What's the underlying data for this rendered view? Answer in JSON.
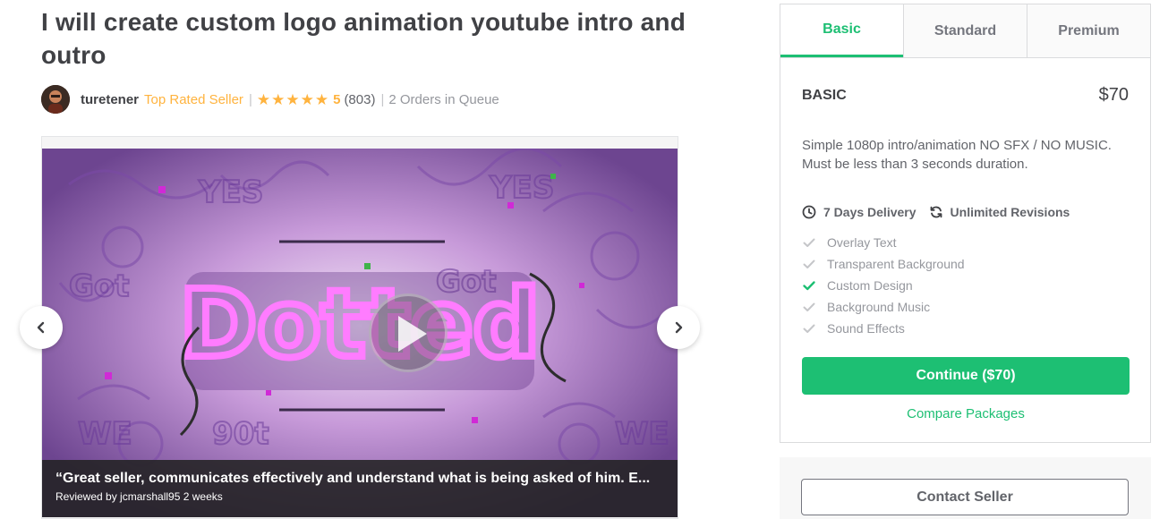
{
  "gig": {
    "title": "I will create custom logo animation youtube intro and outro"
  },
  "seller": {
    "username": "turetener",
    "level": "Top Rated Seller",
    "rating": "5",
    "rating_count": "(803)",
    "queue": "2 Orders in Queue",
    "stars": 5
  },
  "media": {
    "review_text": "“Great seller, communicates effectively and understand what is being asked of him. E...",
    "review_meta": "Reviewed by jcmarshall95 2 weeks",
    "thumbnail_word": "Dotted"
  },
  "packages": {
    "tabs": [
      "Basic",
      "Standard",
      "Premium"
    ],
    "active_tab": "Basic",
    "name": "BASIC",
    "price": "$70",
    "description": "Simple 1080p intro/animation NO SFX / NO MUSIC. Must be less than 3 seconds duration.",
    "delivery": "7 Days Delivery",
    "revisions": "Unlimited Revisions",
    "features": [
      {
        "label": "Overlay Text",
        "included": false
      },
      {
        "label": "Transparent Background",
        "included": false
      },
      {
        "label": "Custom Design",
        "included": true
      },
      {
        "label": "Background Music",
        "included": false
      },
      {
        "label": "Sound Effects",
        "included": false
      }
    ],
    "continue_label": "Continue ($70)",
    "compare_label": "Compare Packages"
  },
  "contact": {
    "label": "Contact Seller"
  },
  "colors": {
    "accent": "#1dbf73",
    "star": "#ffb33e",
    "included_check": "#1dbf73",
    "excluded_check": "#c5c6c9"
  }
}
